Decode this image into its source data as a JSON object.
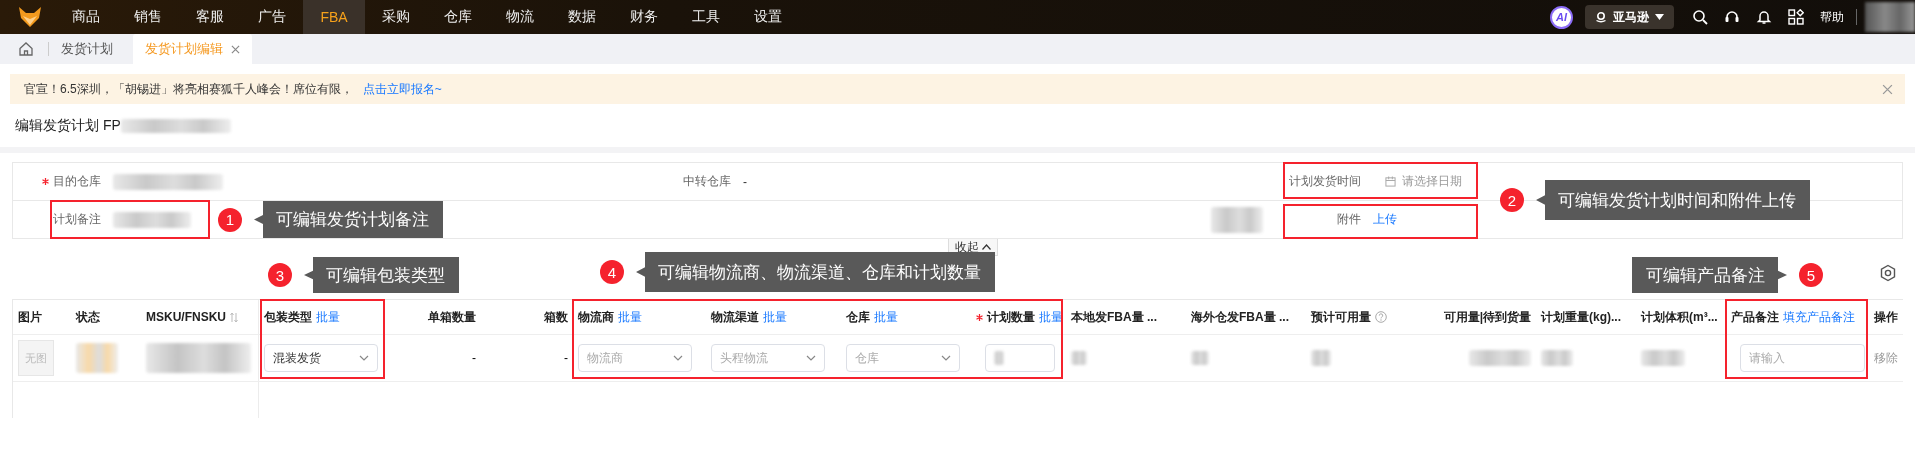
{
  "nav": {
    "items": [
      {
        "label": "商品",
        "selected": false
      },
      {
        "label": "销售",
        "selected": false
      },
      {
        "label": "客服",
        "selected": false
      },
      {
        "label": "广告",
        "selected": false
      },
      {
        "label": "FBA",
        "selected": true
      },
      {
        "label": "采购",
        "selected": false
      },
      {
        "label": "仓库",
        "selected": false
      },
      {
        "label": "物流",
        "selected": false
      },
      {
        "label": "数据",
        "selected": false
      },
      {
        "label": "财务",
        "selected": false
      },
      {
        "label": "工具",
        "selected": false
      },
      {
        "label": "设置",
        "selected": false
      }
    ],
    "ai_label": "AI",
    "platform": "亚马逊",
    "help": "帮助"
  },
  "tabs": [
    {
      "label": "发货计划",
      "selected": false,
      "closable": false
    },
    {
      "label": "发货计划编辑",
      "selected": true,
      "closable": true
    }
  ],
  "notice": {
    "text": "官宣！6.5深圳，「胡锡进」将亮相赛狐千人峰会！席位有限，",
    "link": "点击立即报名~"
  },
  "title": "编辑发货计划 FP",
  "form": {
    "rows": [
      [
        {
          "label": "目的仓库",
          "required": true,
          "kind": "blurred"
        },
        {
          "label": "中转仓库",
          "required": false,
          "kind": "text",
          "value": "-"
        },
        {
          "label": "计划发货时间",
          "required": false,
          "kind": "date",
          "placeholder": "请选择日期"
        }
      ],
      [
        {
          "label": "计划备注",
          "required": false,
          "kind": "blurred"
        },
        {
          "kind": "blurred"
        },
        {
          "label": "附件",
          "required": false,
          "kind": "link",
          "value": "上传"
        }
      ]
    ]
  },
  "collapse": "收起",
  "annotations": [
    {
      "number": "1",
      "text": "可编辑发货计划备注",
      "kind": "tip-after"
    },
    {
      "number": "2",
      "text": "可编辑发货计划时间和附件上传",
      "kind": "tip-after"
    },
    {
      "number": "3",
      "text": "可编辑包装类型",
      "kind": "tip-after"
    },
    {
      "number": "4",
      "text": "可编辑物流商、物流渠道、仓库和计划数量",
      "kind": "tip-after"
    },
    {
      "number": "5",
      "text": "可编辑产品备注",
      "kind": "tip-before"
    }
  ],
  "table": {
    "columns": [
      {
        "label": "图片"
      },
      {
        "label": "状态"
      },
      {
        "label": "MSKU/FNSKU",
        "sortable": true
      },
      {
        "label": "包装类型",
        "action": "批量"
      },
      {
        "label": "单箱数量"
      },
      {
        "label": "箱数"
      },
      {
        "label": "物流商",
        "action": "批量"
      },
      {
        "label": "物流渠道",
        "action": "批量"
      },
      {
        "label": "仓库",
        "action": "批量"
      },
      {
        "label": "计划数量",
        "required": true,
        "action": "批量"
      },
      {
        "label": "本地发FBA量 ..."
      },
      {
        "label": "海外仓发FBA量 ..."
      },
      {
        "label": "预计可用量",
        "help": true
      },
      {
        "label": "可用量|待到货量"
      },
      {
        "label": "计划重量(kg)..."
      },
      {
        "label": "计划体积(m³..."
      },
      {
        "label": "产品备注",
        "action": "填充产品备注"
      },
      {
        "label": "操作"
      }
    ],
    "rows": [
      {
        "cells": [
          {
            "kind": "no-image",
            "text": "无图"
          },
          {
            "kind": "blurred"
          },
          {
            "kind": "blurred"
          },
          {
            "kind": "select",
            "value": "混装发货"
          },
          {
            "kind": "text",
            "text": "-"
          },
          {
            "kind": "text",
            "text": "-"
          },
          {
            "kind": "select",
            "placeholder": "物流商"
          },
          {
            "kind": "select",
            "placeholder": "头程物流"
          },
          {
            "kind": "select",
            "placeholder": "仓库"
          },
          {
            "kind": "input-blurred"
          },
          {
            "kind": "blurred"
          },
          {
            "kind": "blurred"
          },
          {
            "kind": "blurred"
          },
          {
            "kind": "blurred"
          },
          {
            "kind": "blurred"
          },
          {
            "kind": "blurred"
          },
          {
            "kind": "input",
            "placeholder": "请输入"
          },
          {
            "kind": "action",
            "text": "移除"
          }
        ]
      }
    ]
  }
}
